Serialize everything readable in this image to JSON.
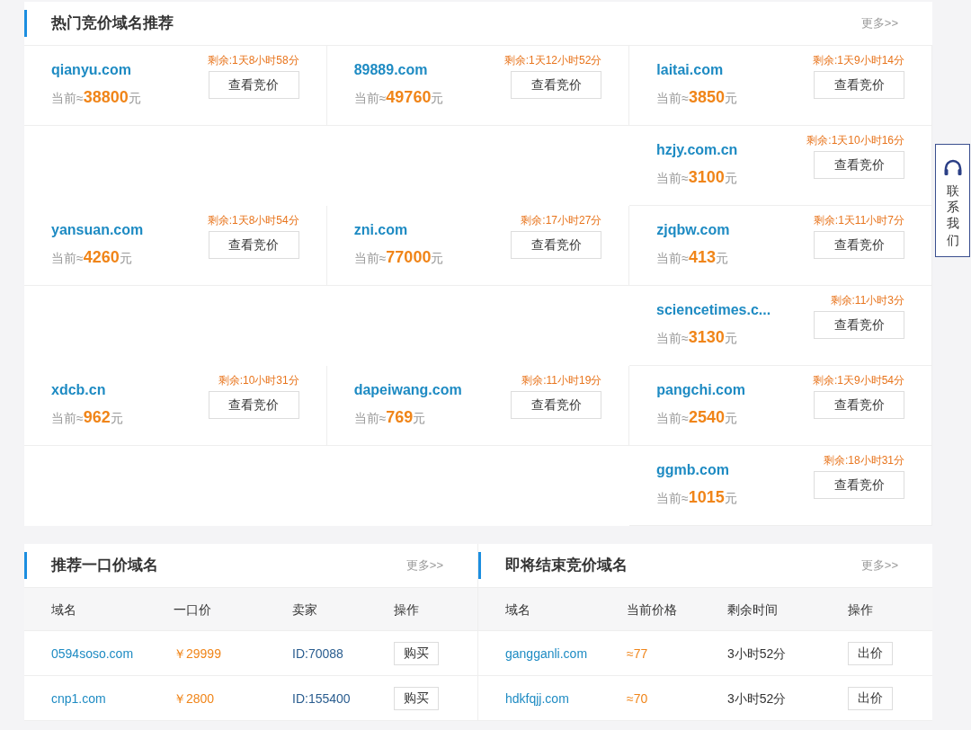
{
  "hot_auctions": {
    "title": "热门竞价域名推荐",
    "more": "更多>>",
    "rows": [
      {
        "auctions": [
          {
            "domain": "qianyu.com",
            "remaining": "剩余:1天8小时58分",
            "prefix": "当前≈",
            "price": "38800",
            "unit": "元",
            "button": "查看竞价"
          },
          {
            "domain": "89889.com",
            "remaining": "剩余:1天12小时52分",
            "prefix": "当前≈",
            "price": "49760",
            "unit": "元",
            "button": "查看竞价"
          },
          {
            "domain": "laitai.com",
            "remaining": "剩余:1天9小时14分",
            "prefix": "当前≈",
            "price": "3850",
            "unit": "元",
            "button": "查看竞价"
          }
        ]
      },
      {
        "auctions": [
          {
            "domain": "hzjy.com.cn",
            "remaining": "剩余:1天10小时16分",
            "prefix": "当前≈",
            "price": "3100",
            "unit": "元",
            "button": "查看竞价"
          }
        ]
      },
      {
        "auctions": [
          {
            "domain": "yansuan.com",
            "remaining": "剩余:1天8小时54分",
            "prefix": "当前≈",
            "price": "4260",
            "unit": "元",
            "button": "查看竞价"
          },
          {
            "domain": "zni.com",
            "remaining": "剩余:17小时27分",
            "prefix": "当前≈",
            "price": "77000",
            "unit": "元",
            "button": "查看竞价"
          },
          {
            "domain": "zjqbw.com",
            "remaining": "剩余:1天11小时7分",
            "prefix": "当前≈",
            "price": "413",
            "unit": "元",
            "button": "查看竞价"
          }
        ]
      },
      {
        "auctions": [
          {
            "domain": "sciencetimes.c...",
            "remaining": "剩余:11小时3分",
            "prefix": "当前≈",
            "price": "3130",
            "unit": "元",
            "button": "查看竞价"
          }
        ]
      },
      {
        "auctions": [
          {
            "domain": "xdcb.cn",
            "remaining": "剩余:10小时31分",
            "prefix": "当前≈",
            "price": "962",
            "unit": "元",
            "button": "查看竞价"
          },
          {
            "domain": "dapeiwang.com",
            "remaining": "剩余:11小时19分",
            "prefix": "当前≈",
            "price": "769",
            "unit": "元",
            "button": "查看竞价"
          },
          {
            "domain": "pangchi.com",
            "remaining": "剩余:1天9小时54分",
            "prefix": "当前≈",
            "price": "2540",
            "unit": "元",
            "button": "查看竞价"
          }
        ]
      },
      {
        "auctions": [
          {
            "domain": "ggmb.com",
            "remaining": "剩余:18小时31分",
            "prefix": "当前≈",
            "price": "1015",
            "unit": "元",
            "button": "查看竞价"
          }
        ]
      }
    ]
  },
  "contact": {
    "label": "联系我们"
  },
  "fixed_price": {
    "title": "推荐一口价域名",
    "more": "更多>>",
    "columns": [
      "域名",
      "一口价",
      "卖家",
      "操作"
    ],
    "rows": [
      {
        "domain": "0594soso.com",
        "price": "￥29999",
        "seller": "ID:70088",
        "action": "购买"
      },
      {
        "domain": "cnp1.com",
        "price": "￥2800",
        "seller": "ID:155400",
        "action": "购买"
      }
    ]
  },
  "ending": {
    "title": "即将结束竞价域名",
    "more": "更多>>",
    "columns": [
      "域名",
      "当前价格",
      "剩余时间",
      "操作"
    ],
    "rows": [
      {
        "domain": "gangganli.com",
        "price": "≈77",
        "remaining": "3小时52分",
        "action": "出价"
      },
      {
        "domain": "hdkfqjj.com",
        "price": "≈70",
        "remaining": "3小时52分",
        "action": "出价"
      }
    ]
  }
}
